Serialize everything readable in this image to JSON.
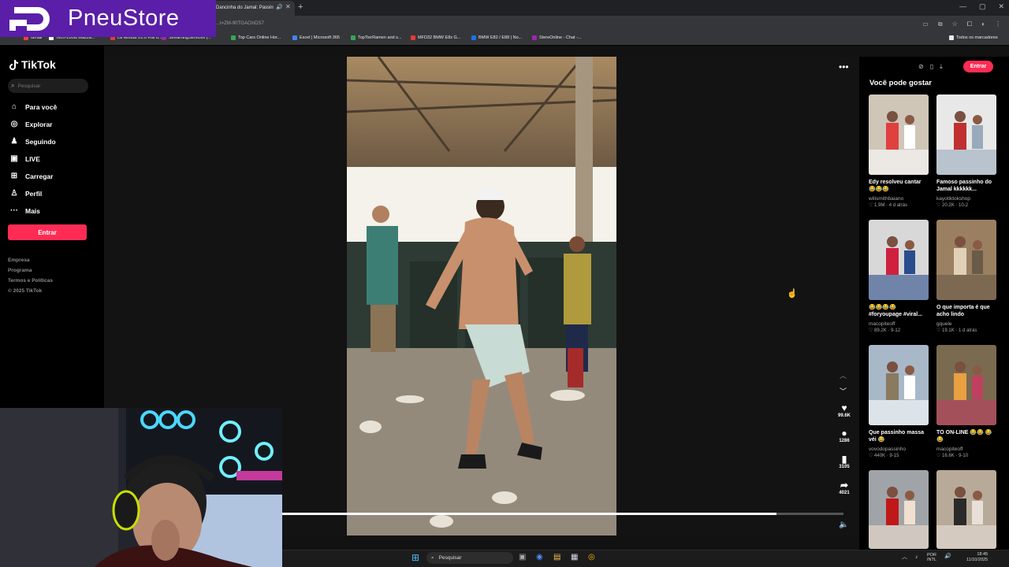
{
  "browser": {
    "tab_title": "Dancinha do Jamal: Passin",
    "url": "...t=ZM-90TGACInDS7",
    "bookmarks": [
      {
        "label": "Gmail",
        "color": "#ea4335"
      },
      {
        "label": "Tech-Loots Mazza...",
        "color": "#ffffff"
      },
      {
        "label": "La Minuta V2.0 Full d...",
        "color": "#e53935"
      },
      {
        "label": "StreamingServices |...",
        "color": "#9c27b0"
      },
      {
        "label": "Top Cars Online Hor...",
        "color": "#34a853"
      },
      {
        "label": "Excel | Microsoft 365",
        "color": "#4285f4"
      },
      {
        "label": "TopTierRamen and s...",
        "color": "#34a853"
      },
      {
        "label": "MFD32 BMW E8x G...",
        "color": "#e53935"
      },
      {
        "label": "BMW E82 / E88 | No...",
        "color": "#1a73e8"
      },
      {
        "label": "StereOnline - Chat -...",
        "color": "#9c27b0"
      }
    ],
    "all_bookmarks": "Todos os marcadores"
  },
  "overlay": {
    "brand": "PneuStore",
    "brand_color": "#5a1ea8"
  },
  "tiktok": {
    "logo": "TikTok",
    "search_placeholder": "Pesquisar",
    "nav": [
      {
        "label": "Para você",
        "icon": "home-icon"
      },
      {
        "label": "Explorar",
        "icon": "compass-icon"
      },
      {
        "label": "Seguindo",
        "icon": "following-icon"
      },
      {
        "label": "LIVE",
        "icon": "live-icon"
      },
      {
        "label": "Carregar",
        "icon": "upload-icon"
      },
      {
        "label": "Perfil",
        "icon": "profile-icon"
      },
      {
        "label": "Mais",
        "icon": "more-icon"
      }
    ],
    "login_label": "Entrar",
    "footer": [
      "Empresa",
      "Programa",
      "Termos e Políticas",
      "© 2025 TikTok"
    ],
    "accent": "#fe2c55"
  },
  "player": {
    "likes": "99.6K",
    "comments": "1286",
    "saves": "3105",
    "shares": "4021",
    "progress": 0.88
  },
  "recommendations": {
    "title": "Você pode gostar",
    "login_label": "Entrar",
    "items": [
      {
        "title": "Edy resolveu cantar 😂😂😂",
        "author": "wilismithbaiano",
        "meta": "♡ 1.9M · 4 d atrás"
      },
      {
        "title": "Famoso passinho do Jamal kkkkkk...",
        "author": "kayotiktokshop",
        "meta": "♡ 20.2K · 10-2"
      },
      {
        "title": "😂😂😂😂 #foryoupage #viral...",
        "author": "macopiteoff",
        "meta": "♡ 89.2K · 9-12"
      },
      {
        "title": "O que importa é que acho lindo",
        "author": "gquele",
        "meta": "♡ 19.1K · 1 d atrás"
      },
      {
        "title": "Que passinho massa véi 😂",
        "author": "vovodopassinho",
        "meta": "♡ 440K · 9-15"
      },
      {
        "title": "TÔ ON-LINE 😂😂 😂😂",
        "author": "macopiteoff",
        "meta": "♡ 16.6K · 9-10"
      },
      {
        "title": "",
        "author": "",
        "meta": ""
      },
      {
        "title": "",
        "author": "",
        "meta": ""
      }
    ]
  },
  "taskbar": {
    "search": "Pesquisar",
    "lang_top": "POR",
    "lang_bottom": "INTL",
    "time": "18:45",
    "date": "11/10/2025"
  }
}
